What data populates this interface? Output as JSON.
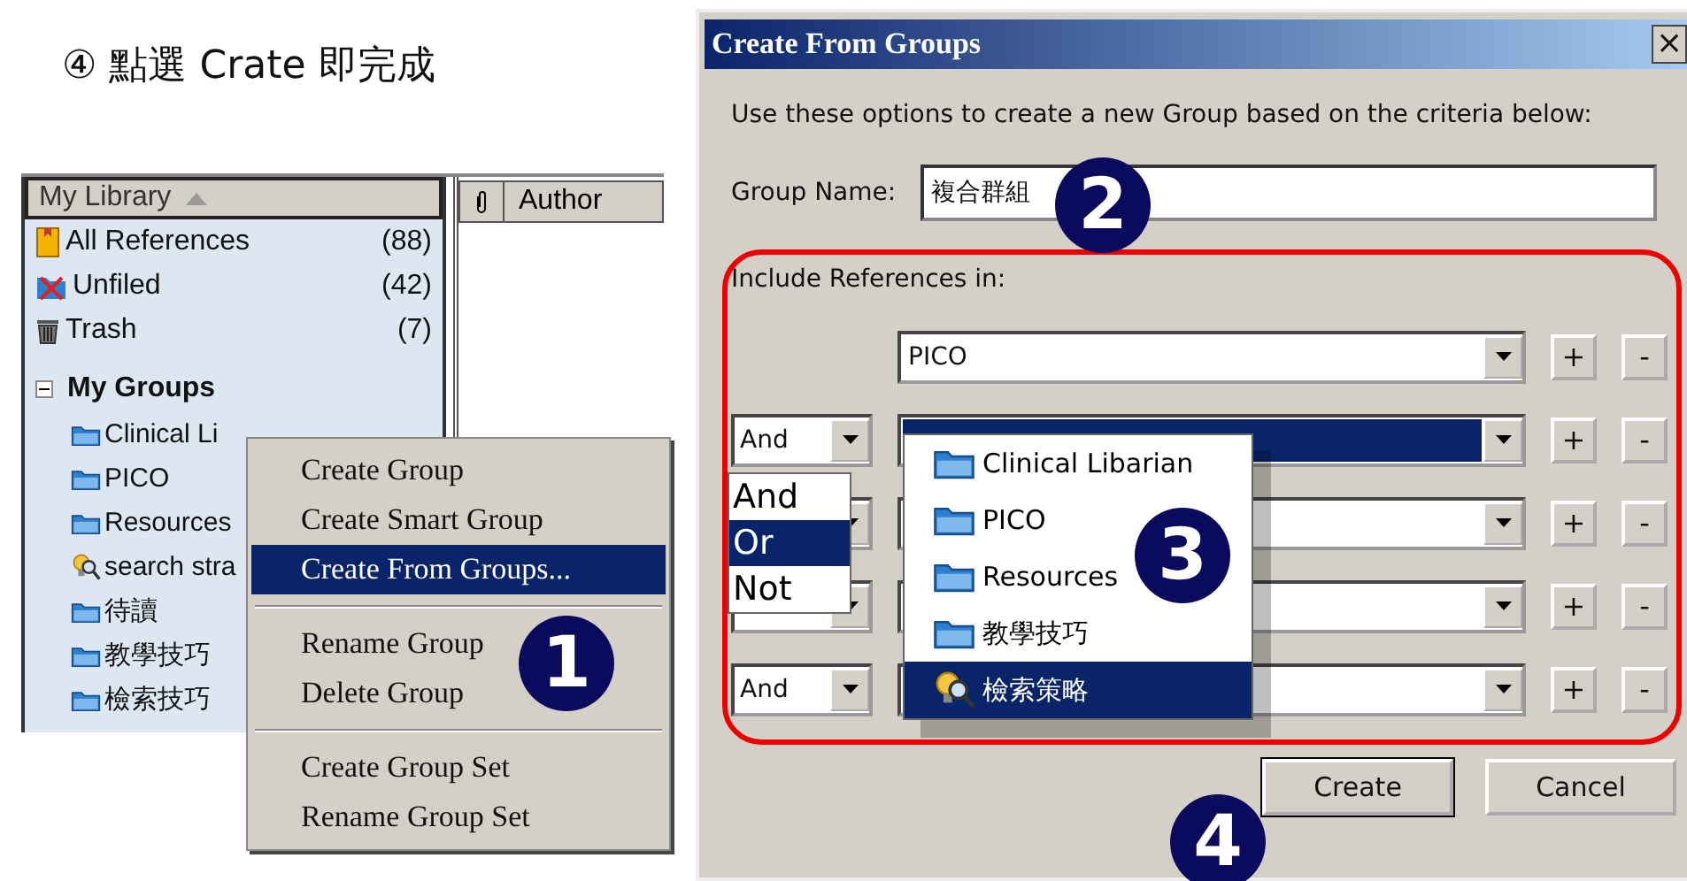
{
  "caption": "④ 點選 Crate 即完成",
  "library": {
    "header": "My Library",
    "author_column": "Author",
    "items": [
      {
        "label": "All References",
        "count": "(88)",
        "kind": "all"
      },
      {
        "label": "Unfiled",
        "count": "(42)",
        "kind": "unfiled"
      },
      {
        "label": "Trash",
        "count": "(7)",
        "kind": "trash"
      }
    ],
    "groups_heading": "My Groups",
    "expanded": true,
    "groups": [
      {
        "label": "Clinical Li",
        "kind": "folder"
      },
      {
        "label": "PICO",
        "kind": "folder"
      },
      {
        "label": "Resources",
        "kind": "folder"
      },
      {
        "label": "search stra",
        "kind": "smart"
      },
      {
        "label": "待讀",
        "kind": "folder"
      },
      {
        "label": "教學技巧",
        "kind": "folder"
      },
      {
        "label": "檢索技巧",
        "kind": "folder"
      }
    ]
  },
  "context_menu": {
    "sections": [
      [
        {
          "label": "Create Group",
          "selected": false
        },
        {
          "label": "Create Smart Group",
          "selected": false
        },
        {
          "label": "Create From Groups...",
          "selected": true
        }
      ],
      [
        {
          "label": "Rename Group",
          "selected": false
        },
        {
          "label": "Delete Group",
          "selected": false
        }
      ],
      [
        {
          "label": "Create Group Set",
          "selected": false
        },
        {
          "label": "Rename Group Set",
          "selected": false
        }
      ]
    ]
  },
  "steps": [
    "1",
    "2",
    "3",
    "4"
  ],
  "dialog": {
    "title": "Create From Groups",
    "close": "×",
    "instructions": "Use these options to create a new Group based on the criteria below:",
    "group_name_label": "Group Name:",
    "group_name_value": "複合群組",
    "include_label": "Include References in:",
    "rows": [
      {
        "operator": "",
        "group": "PICO",
        "selected": false
      },
      {
        "operator": "And",
        "group": "",
        "selected": true
      },
      {
        "operator": "",
        "group": "",
        "selected": false
      },
      {
        "operator": "",
        "group": "",
        "selected": false
      },
      {
        "operator": "And",
        "group": "",
        "selected": false
      }
    ],
    "add": "+",
    "remove": "-",
    "operator_options": [
      {
        "label": "And",
        "selected": false
      },
      {
        "label": "Or",
        "selected": true
      },
      {
        "label": "Not",
        "selected": false
      }
    ],
    "group_options": [
      {
        "label": "Clinical Libarian",
        "kind": "folder",
        "selected": false
      },
      {
        "label": "PICO",
        "kind": "folder",
        "selected": false
      },
      {
        "label": "Resources",
        "kind": "folder",
        "selected": false
      },
      {
        "label": "教學技巧",
        "kind": "folder",
        "selected": false
      },
      {
        "label": "檢索策略",
        "kind": "smart",
        "selected": true
      }
    ],
    "buttons": [
      "Create",
      "Cancel"
    ]
  }
}
